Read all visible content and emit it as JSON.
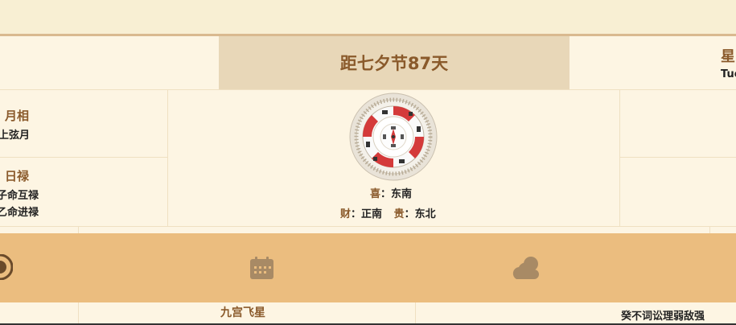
{
  "header": {
    "countdown": "距七夕节87天"
  },
  "weekday": {
    "label": "星",
    "english": "Tue"
  },
  "moon": {
    "label": "月相",
    "value": "上弦月"
  },
  "day_lu": {
    "label": "日禄",
    "line1": "子命互禄",
    "line2": "乙命进禄"
  },
  "directions": {
    "xi_label": "喜",
    "xi_value": "东南",
    "cai_label": "财",
    "cai_value": "正南",
    "gui_label": "贵",
    "gui_value": "东北",
    "separator": "："
  },
  "icons": {
    "left": "moon-phase-icon",
    "calendar": "calendar-icon",
    "weather": "weather-icon"
  },
  "bottom": {
    "nine_palace": "九宫飞星",
    "right_text": "癸不词讼理弱敌强"
  },
  "colors": {
    "accent": "#8a5a2b",
    "highlight": "#e8d7b8",
    "iconbar": "#ebbd7f",
    "background": "#fdf5e3"
  }
}
